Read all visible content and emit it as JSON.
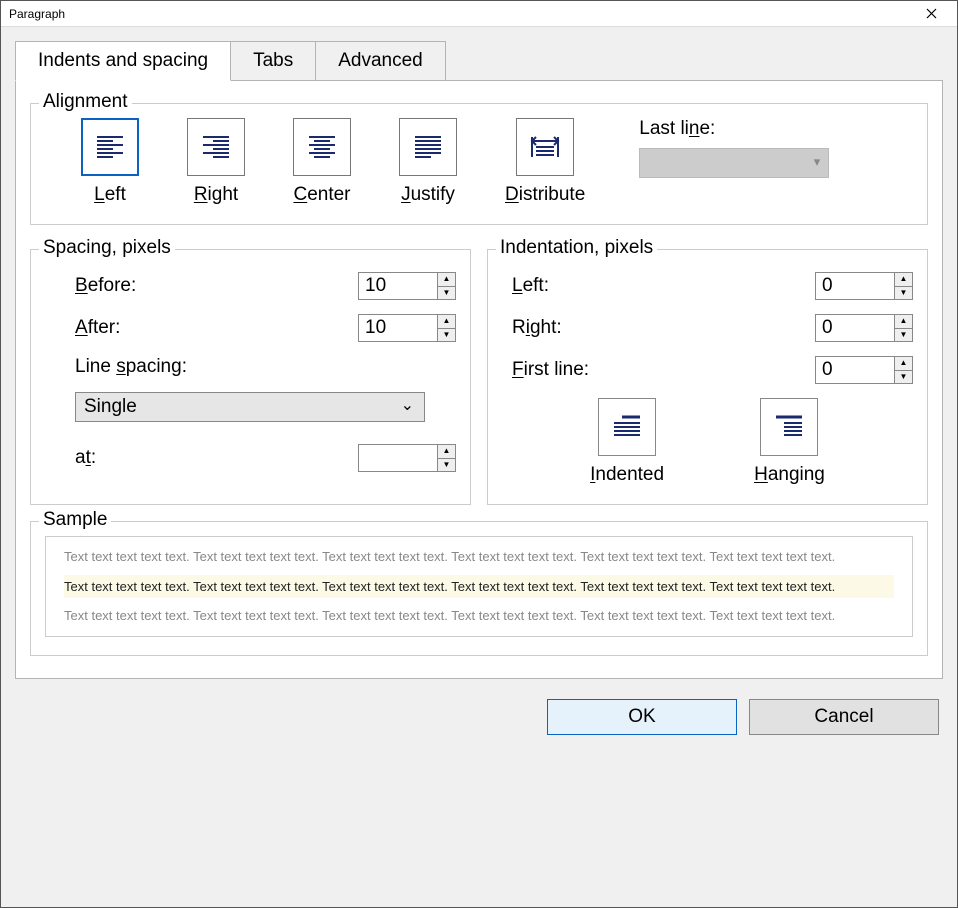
{
  "window": {
    "title": "Paragraph"
  },
  "tabs": {
    "indents": "Indents and spacing",
    "tabs": "Tabs",
    "advanced": "Advanced"
  },
  "alignment": {
    "legend": "Alignment",
    "options": {
      "left": "eft",
      "right": "ight",
      "center": "enter",
      "justify": "ustify",
      "distribute": "istribute"
    },
    "keys": {
      "left": "L",
      "right": "R",
      "center": "C",
      "justify": "J",
      "distribute": "D"
    },
    "lastline_label_pre": "Last li",
    "lastline_label_key": "n",
    "lastline_label_post": "e:"
  },
  "spacing": {
    "legend": "Spacing, pixels",
    "before_key": "B",
    "before": "efore:",
    "after_key": "A",
    "after": "fter:",
    "linesp_pre": "Line ",
    "linesp_key": "s",
    "linesp_post": "pacing:",
    "at_pre": "a",
    "at_key": "t",
    "at_post": ":",
    "before_val": "10",
    "after_val": "10",
    "line_spacing_val": "Single",
    "at_val": ""
  },
  "indent": {
    "legend": "Indentation, pixels",
    "left_key": "L",
    "left": "eft:",
    "right_pre": "R",
    "right_key": "i",
    "right_post": "ght:",
    "first_key": "F",
    "first": "irst line:",
    "left_val": "0",
    "right_val": "0",
    "first_val": "0",
    "indented_key": "I",
    "indented": "ndented",
    "hanging_key": "H",
    "hanging": "anging"
  },
  "sample": {
    "legend": "Sample",
    "para": "Text text text text text. Text text text text text. Text text text text text. Text text text text text. Text text text text text. Text text text text text."
  },
  "buttons": {
    "ok": "OK",
    "cancel": "Cancel"
  }
}
